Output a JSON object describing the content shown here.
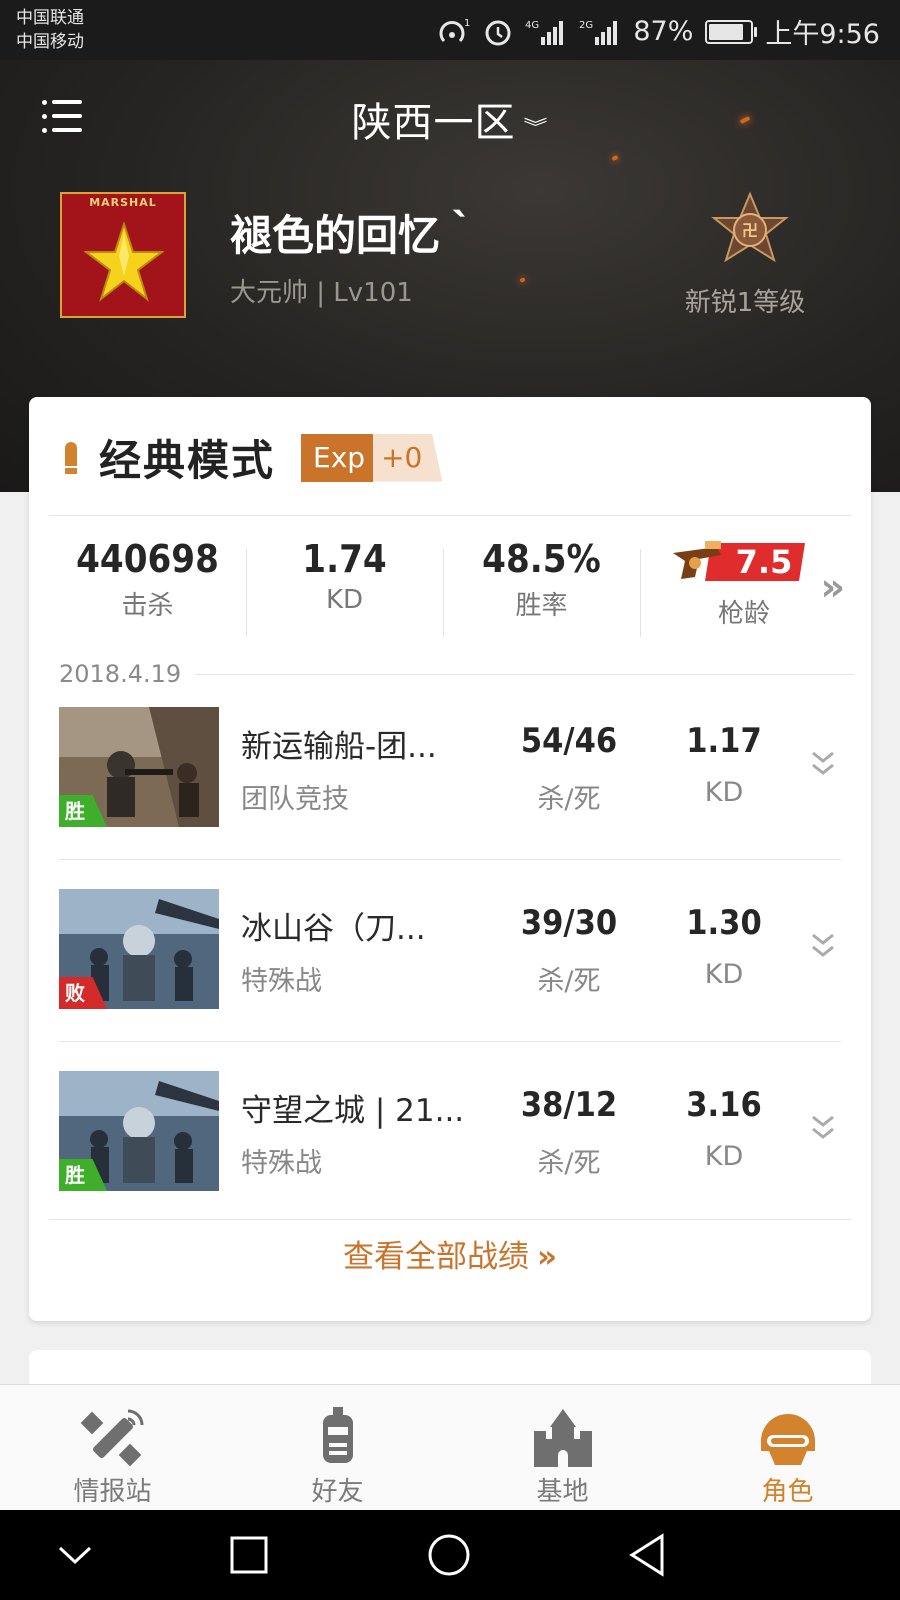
{
  "status_bar": {
    "carrier_1": "中国联通",
    "carrier_2": "中国移动",
    "battery_percent": "87%",
    "time": "上午9:56",
    "signal_labels": [
      "4G",
      "2G"
    ]
  },
  "header": {
    "server_name": "陕西一区",
    "player": {
      "badge_text": "MARSHAL",
      "nickname": "褪色的回忆｀",
      "rank_line": "大元帅 | Lv101",
      "level_label": "新锐1等级"
    }
  },
  "mode_section": {
    "title": "经典模式",
    "exp_label": "Exp",
    "exp_value": "+0",
    "stats": [
      {
        "value": "440698",
        "label": "击杀"
      },
      {
        "value": "1.74",
        "label": "KD"
      },
      {
        "value": "48.5%",
        "label": "胜率"
      }
    ],
    "gun_age": {
      "value": "7.5",
      "label": "枪龄"
    },
    "date": "2018.4.19",
    "matches": [
      {
        "name": "新运输船-团...",
        "mode": "团队竞技",
        "kills_deaths": "54/46",
        "kd_label": "杀/死",
        "kd": "1.17",
        "kd2_label": "KD",
        "result": "胜",
        "result_color": "#3fae2a"
      },
      {
        "name": "冰山谷（刀...",
        "mode": "特殊战",
        "kills_deaths": "39/30",
        "kd_label": "杀/死",
        "kd": "1.30",
        "kd2_label": "KD",
        "result": "败",
        "result_color": "#d42a2a"
      },
      {
        "name": "守望之城 | 21...",
        "mode": "特殊战",
        "kills_deaths": "38/12",
        "kd_label": "杀/死",
        "kd": "3.16",
        "kd2_label": "KD",
        "result": "胜",
        "result_color": "#3fae2a"
      }
    ],
    "view_all_label": "查看全部战绩"
  },
  "tabs": [
    {
      "label": "情报站",
      "icon": "satellite-icon",
      "active": false
    },
    {
      "label": "好友",
      "icon": "robot-friend-icon",
      "active": false
    },
    {
      "label": "基地",
      "icon": "castle-icon",
      "active": false
    },
    {
      "label": "角色",
      "icon": "helmet-icon",
      "active": true
    }
  ],
  "nav_bar": [
    "back-chevron",
    "recents",
    "home",
    "back"
  ],
  "colors": {
    "accent": "#d3822e",
    "win": "#3fae2a",
    "lose": "#d42a2a",
    "gun_tag": "#e02c2c"
  }
}
